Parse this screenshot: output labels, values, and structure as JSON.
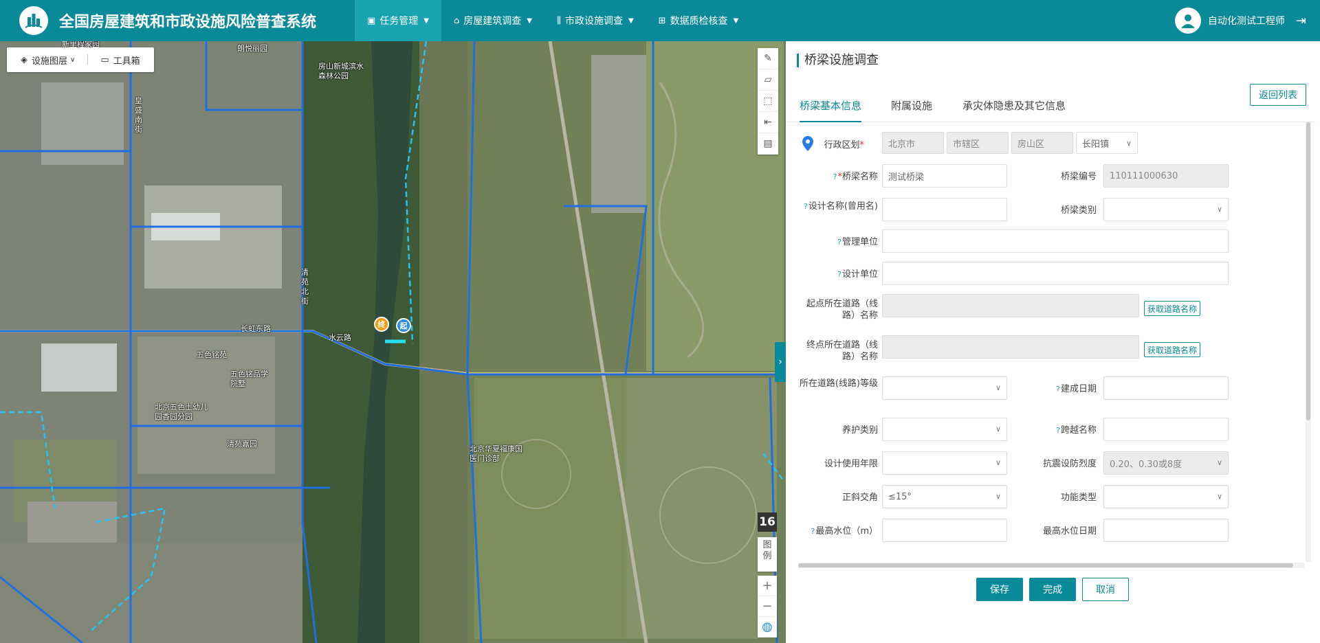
{
  "header": {
    "app_title": "全国房屋建筑和市政设施风险普查系统",
    "nav": [
      {
        "label": "任务管理",
        "icon": "task-icon",
        "active": true
      },
      {
        "label": "房屋建筑调查",
        "icon": "house-icon",
        "active": false
      },
      {
        "label": "市政设施调查",
        "icon": "road-icon",
        "active": false
      },
      {
        "label": "数据质检核查",
        "icon": "check-icon",
        "active": false
      }
    ],
    "user_name": "自动化测试工程师",
    "colors": {
      "header_bg": "#0a8a99",
      "active_tab": "#1aa3b1"
    }
  },
  "map": {
    "toolbar": {
      "layers": "设施图层",
      "toolbox": "工具箱"
    },
    "zoom_level": "16",
    "legend": "图例",
    "marker_end": "终",
    "marker_start": "起",
    "labels": {
      "park": "房山新城滨水森林公园",
      "xinlicheng": "新里程家园",
      "langrun": "朗悦丽园",
      "huangsheng": "皇盛南街",
      "changhong_east": "长虹东路",
      "wuse1": "五色铭苑",
      "wuse2": "五色铭品学院墅",
      "school": "北京五色土幼儿园香园分园",
      "qingyuan": "清苑嘉园",
      "hospital": "北京华夏福康国医门诊部",
      "shuiyun": "水云路",
      "qingjiang": "清苑北街"
    }
  },
  "panel": {
    "title": "桥梁设施调查",
    "back_button": "返回列表",
    "tabs": [
      "桥梁基本信息",
      "附属设施",
      "承灾体隐患及其它信息"
    ],
    "form": {
      "region_label": "行政区划",
      "region": [
        "北京市",
        "市辖区",
        "房山区",
        "长阳镇"
      ],
      "bridge_name_label": "桥梁名称",
      "bridge_name": "测试桥梁",
      "bridge_code_label": "桥梁编号",
      "bridge_code": "110111000630",
      "design_name_label": "设计名称(曾用名)",
      "bridge_type_label": "桥梁类别",
      "mgmt_unit_label": "管理单位",
      "design_unit_label": "设计单位",
      "start_road_label": "起点所在道路（线路）名称",
      "end_road_label": "终点所在道路（线路）名称",
      "get_road_button": "获取道路名称",
      "road_grade_label": "所在道路(线路)等级",
      "build_date_label": "建成日期",
      "maint_type_label": "养护类别",
      "span_name_label": "跨越名称",
      "design_life_label": "设计使用年限",
      "seismic_label": "抗震设防烈度",
      "seismic_value": "0.20、0.30或8度",
      "skew_label": "正斜交角",
      "skew_value": "≤15°",
      "function_label": "功能类型",
      "max_water_label": "最高水位（m）",
      "max_water_date_label": "最高水位日期"
    },
    "buttons": {
      "save": "保存",
      "finish": "完成",
      "cancel": "取消"
    }
  }
}
